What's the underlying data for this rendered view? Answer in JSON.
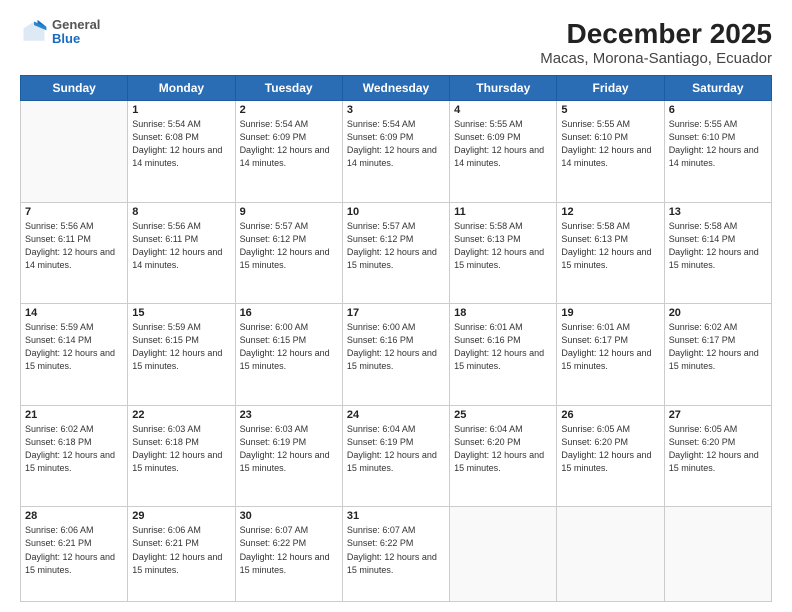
{
  "header": {
    "logo_general": "General",
    "logo_blue": "Blue",
    "title": "December 2025",
    "subtitle": "Macas, Morona-Santiago, Ecuador"
  },
  "calendar": {
    "days_of_week": [
      "Sunday",
      "Monday",
      "Tuesday",
      "Wednesday",
      "Thursday",
      "Friday",
      "Saturday"
    ],
    "weeks": [
      [
        {
          "day": "",
          "info": ""
        },
        {
          "day": "1",
          "info": "Sunrise: 5:54 AM\nSunset: 6:08 PM\nDaylight: 12 hours\nand 14 minutes."
        },
        {
          "day": "2",
          "info": "Sunrise: 5:54 AM\nSunset: 6:09 PM\nDaylight: 12 hours\nand 14 minutes."
        },
        {
          "day": "3",
          "info": "Sunrise: 5:54 AM\nSunset: 6:09 PM\nDaylight: 12 hours\nand 14 minutes."
        },
        {
          "day": "4",
          "info": "Sunrise: 5:55 AM\nSunset: 6:09 PM\nDaylight: 12 hours\nand 14 minutes."
        },
        {
          "day": "5",
          "info": "Sunrise: 5:55 AM\nSunset: 6:10 PM\nDaylight: 12 hours\nand 14 minutes."
        },
        {
          "day": "6",
          "info": "Sunrise: 5:55 AM\nSunset: 6:10 PM\nDaylight: 12 hours\nand 14 minutes."
        }
      ],
      [
        {
          "day": "7",
          "info": "Sunrise: 5:56 AM\nSunset: 6:11 PM\nDaylight: 12 hours\nand 14 minutes."
        },
        {
          "day": "8",
          "info": "Sunrise: 5:56 AM\nSunset: 6:11 PM\nDaylight: 12 hours\nand 14 minutes."
        },
        {
          "day": "9",
          "info": "Sunrise: 5:57 AM\nSunset: 6:12 PM\nDaylight: 12 hours\nand 15 minutes."
        },
        {
          "day": "10",
          "info": "Sunrise: 5:57 AM\nSunset: 6:12 PM\nDaylight: 12 hours\nand 15 minutes."
        },
        {
          "day": "11",
          "info": "Sunrise: 5:58 AM\nSunset: 6:13 PM\nDaylight: 12 hours\nand 15 minutes."
        },
        {
          "day": "12",
          "info": "Sunrise: 5:58 AM\nSunset: 6:13 PM\nDaylight: 12 hours\nand 15 minutes."
        },
        {
          "day": "13",
          "info": "Sunrise: 5:58 AM\nSunset: 6:14 PM\nDaylight: 12 hours\nand 15 minutes."
        }
      ],
      [
        {
          "day": "14",
          "info": "Sunrise: 5:59 AM\nSunset: 6:14 PM\nDaylight: 12 hours\nand 15 minutes."
        },
        {
          "day": "15",
          "info": "Sunrise: 5:59 AM\nSunset: 6:15 PM\nDaylight: 12 hours\nand 15 minutes."
        },
        {
          "day": "16",
          "info": "Sunrise: 6:00 AM\nSunset: 6:15 PM\nDaylight: 12 hours\nand 15 minutes."
        },
        {
          "day": "17",
          "info": "Sunrise: 6:00 AM\nSunset: 6:16 PM\nDaylight: 12 hours\nand 15 minutes."
        },
        {
          "day": "18",
          "info": "Sunrise: 6:01 AM\nSunset: 6:16 PM\nDaylight: 12 hours\nand 15 minutes."
        },
        {
          "day": "19",
          "info": "Sunrise: 6:01 AM\nSunset: 6:17 PM\nDaylight: 12 hours\nand 15 minutes."
        },
        {
          "day": "20",
          "info": "Sunrise: 6:02 AM\nSunset: 6:17 PM\nDaylight: 12 hours\nand 15 minutes."
        }
      ],
      [
        {
          "day": "21",
          "info": "Sunrise: 6:02 AM\nSunset: 6:18 PM\nDaylight: 12 hours\nand 15 minutes."
        },
        {
          "day": "22",
          "info": "Sunrise: 6:03 AM\nSunset: 6:18 PM\nDaylight: 12 hours\nand 15 minutes."
        },
        {
          "day": "23",
          "info": "Sunrise: 6:03 AM\nSunset: 6:19 PM\nDaylight: 12 hours\nand 15 minutes."
        },
        {
          "day": "24",
          "info": "Sunrise: 6:04 AM\nSunset: 6:19 PM\nDaylight: 12 hours\nand 15 minutes."
        },
        {
          "day": "25",
          "info": "Sunrise: 6:04 AM\nSunset: 6:20 PM\nDaylight: 12 hours\nand 15 minutes."
        },
        {
          "day": "26",
          "info": "Sunrise: 6:05 AM\nSunset: 6:20 PM\nDaylight: 12 hours\nand 15 minutes."
        },
        {
          "day": "27",
          "info": "Sunrise: 6:05 AM\nSunset: 6:20 PM\nDaylight: 12 hours\nand 15 minutes."
        }
      ],
      [
        {
          "day": "28",
          "info": "Sunrise: 6:06 AM\nSunset: 6:21 PM\nDaylight: 12 hours\nand 15 minutes."
        },
        {
          "day": "29",
          "info": "Sunrise: 6:06 AM\nSunset: 6:21 PM\nDaylight: 12 hours\nand 15 minutes."
        },
        {
          "day": "30",
          "info": "Sunrise: 6:07 AM\nSunset: 6:22 PM\nDaylight: 12 hours\nand 15 minutes."
        },
        {
          "day": "31",
          "info": "Sunrise: 6:07 AM\nSunset: 6:22 PM\nDaylight: 12 hours\nand 15 minutes."
        },
        {
          "day": "",
          "info": ""
        },
        {
          "day": "",
          "info": ""
        },
        {
          "day": "",
          "info": ""
        }
      ]
    ]
  }
}
